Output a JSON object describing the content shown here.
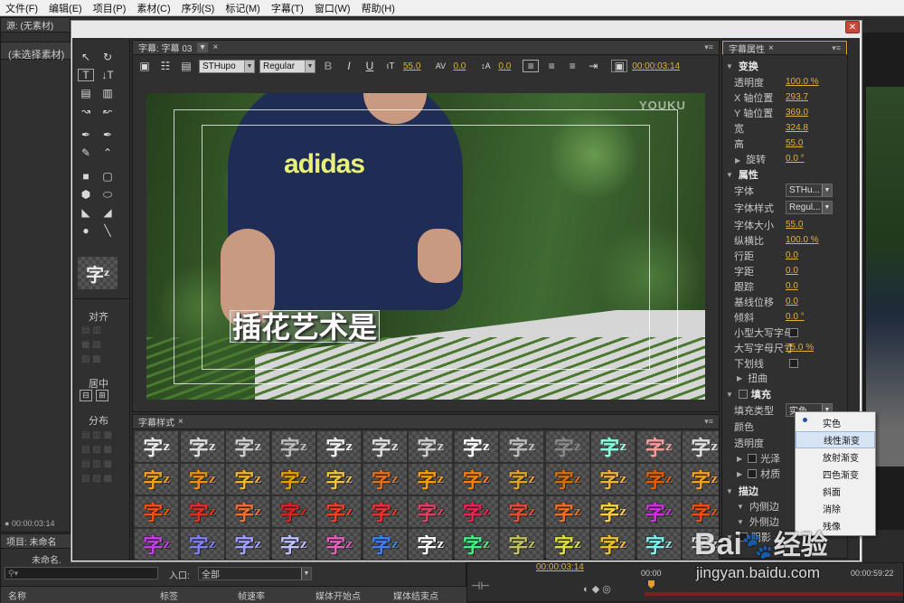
{
  "menubar": [
    "文件(F)",
    "编辑(E)",
    "项目(P)",
    "素材(C)",
    "序列(S)",
    "标记(M)",
    "字幕(T)",
    "窗口(W)",
    "帮助(H)"
  ],
  "source_panel": {
    "tab": "源: (无素材)",
    "content": "(未选择素材)",
    "timecode": "00:00:03:14"
  },
  "project_panel": {
    "tab": "项目: 未命名",
    "item": "未命名.",
    "search_placeholder": "",
    "inpoint_label": "入口:",
    "inpoint_value": "全部",
    "columns": [
      "名称",
      "标签",
      "帧速率",
      "媒体开始点",
      "媒体结束点"
    ]
  },
  "timeline": {
    "timecode": "00:00:03:14",
    "ruler_start": "00:00",
    "ruler_end": "00:00:59:22"
  },
  "title_panel": {
    "tab": "字幕: 字幕 03",
    "font": "STHupo",
    "style": "Regular",
    "size": "55.0",
    "kerning": "0.0",
    "leading": "0.0",
    "timecode": "00:00:03:14",
    "video_text": "插花艺术是",
    "shirt_text": "adidas",
    "watermark": "YOUKU"
  },
  "tools_panel": {
    "align": "对齐",
    "center": "居中",
    "distribute": "分布",
    "preview_glyph": "字"
  },
  "styles_panel": {
    "tab": "字幕样式",
    "glyph": "字"
  },
  "props_panel": {
    "tab": "字幕属性",
    "transform": {
      "title": "变换",
      "opacity_label": "透明度",
      "opacity": "100.0 %",
      "x_label": "X 轴位置",
      "x": "293.7",
      "y_label": "Y 轴位置",
      "y": "369.0",
      "w_label": "宽",
      "w": "324.8",
      "h_label": "高",
      "h": "55.0",
      "rot_label": "旋转",
      "rot": "0.0 °"
    },
    "properties": {
      "title": "属性",
      "font_label": "字体",
      "font": "STHu...",
      "style_label": "字体样式",
      "style": "Regul...",
      "size_label": "字体大小",
      "size": "55.0",
      "aspect_label": "纵横比",
      "aspect": "100.0 %",
      "leading_label": "行距",
      "leading": "0.0",
      "kerning_label": "字距",
      "kerning": "0.0",
      "tracking_label": "跟踪",
      "tracking": "0.0",
      "baseline_label": "基线位移",
      "baseline": "0.0",
      "slant_label": "倾斜",
      "slant": "0.0 °",
      "smallcaps_label": "小型大写字母",
      "smallcaps_size_label": "大写字母尺寸",
      "smallcaps_size": "75.0 %",
      "underline_label": "下划线",
      "distort_label": "扭曲"
    },
    "fill": {
      "title": "填充",
      "type_label": "填充类型",
      "type_value": "实色",
      "color_label": "颜色",
      "opacity_label": "透明度",
      "sheen_label": "光泽",
      "texture_label": "材质"
    },
    "stroke": {
      "title": "描边",
      "inner_label": "内侧边",
      "outer_label": "外侧边",
      "shadow_label": "阴影"
    }
  },
  "fill_dropdown": {
    "options": [
      "实色",
      "线性渐变",
      "放射渐变",
      "四色渐变",
      "斜面",
      "消除",
      "残像"
    ],
    "selected": "实色",
    "highlighted": "线性渐变"
  },
  "watermark": {
    "brand": "Bai",
    "brand_cn": "经验",
    "url": "jingyan.baidu.com"
  }
}
